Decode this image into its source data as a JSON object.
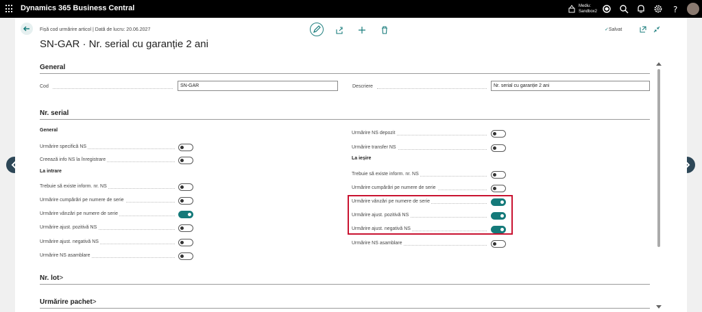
{
  "app": {
    "title": "Dynamics 365 Business Central",
    "env_line1": "Mediu:",
    "env_line2": "Sandbox2"
  },
  "header": {
    "breadcrumb": "Fișă cod urmărire articol | Dată de lucru: 20.06.2027",
    "title": "SN-GAR · Nr. serial cu garanție 2 ani",
    "saved": "Salvat"
  },
  "general": {
    "heading": "General",
    "cod_label": "Cod",
    "cod_value": "SN-GAR",
    "desc_label": "Descriere",
    "desc_value": "Nr. serial cu garanție 2 ani"
  },
  "serial": {
    "heading": "Nr. serial",
    "left_general": "General",
    "left_intrare": "La intrare",
    "right_iesire": "La ieșire",
    "left_items": [
      {
        "label": "Urmărire specifică NS",
        "on": false
      },
      {
        "label": "Creează info NS la înregistrare",
        "on": false
      },
      {
        "label": "Trebuie să existe inform. nr. NS",
        "on": false
      },
      {
        "label": "Urmărire cumpărări pe numere de serie",
        "on": false
      },
      {
        "label": "Urmărire vânzări pe numere de serie",
        "on": true
      },
      {
        "label": "Urmărire ajust. pozitivă NS",
        "on": false
      },
      {
        "label": "Urmărire ajust. negativă NS",
        "on": false
      },
      {
        "label": "Urmărire NS asamblare",
        "on": false
      }
    ],
    "right_items": [
      {
        "label": "Urmărire NS depozit",
        "on": false
      },
      {
        "label": "Urmărire transfer NS",
        "on": false
      },
      {
        "label": "Trebuie să existe inform. nr. NS",
        "on": false
      },
      {
        "label": "Urmărire cumpărări pe numere de serie",
        "on": false
      },
      {
        "label": "Urmărire vânzări pe numere de serie",
        "on": true
      },
      {
        "label": "Urmărire ajust. pozitivă NS",
        "on": true
      },
      {
        "label": "Urmărire ajust. negativă NS",
        "on": true
      },
      {
        "label": "Urmărire NS asamblare",
        "on": false
      }
    ]
  },
  "lot": {
    "heading": "Nr. lot",
    "chevron": ">"
  },
  "package": {
    "heading": "Urmărire pachet",
    "chevron": ">"
  },
  "colors": {
    "accent": "#157a7a",
    "highlight": "#c8102e",
    "topbar": "#000000"
  }
}
